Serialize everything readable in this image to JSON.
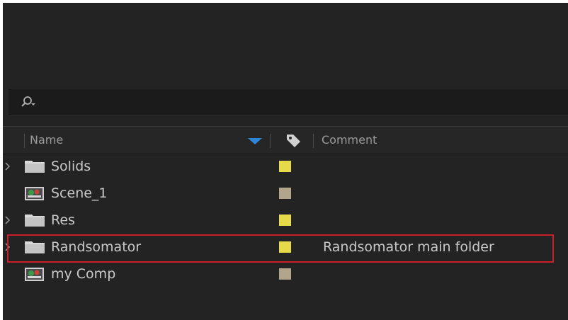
{
  "search": {
    "icon": "search-dropdown-icon"
  },
  "columns": {
    "name": "Name",
    "sort_icon": "sort-descending-icon",
    "label_icon": "tag-icon",
    "comment": "Comment"
  },
  "items": [
    {
      "name": "Solids",
      "type": "folder",
      "label_color": "#e6d94a",
      "comment": "",
      "expandable": true
    },
    {
      "name": "Scene_1",
      "type": "composition",
      "label_color": "#b3a58c",
      "comment": "",
      "expandable": false
    },
    {
      "name": "Res",
      "type": "folder",
      "label_color": "#e6d94a",
      "comment": "",
      "expandable": true
    },
    {
      "name": "Randsomator",
      "type": "folder",
      "label_color": "#e6d94a",
      "comment": "Randsomator main folder",
      "expandable": true,
      "highlighted": true
    },
    {
      "name": "my Comp",
      "type": "composition",
      "label_color": "#b3a58c",
      "comment": "",
      "expandable": false
    }
  ],
  "colors": {
    "panel_bg": "#232323",
    "highlight_border": "#c8202a",
    "sort_arrow": "#2f86d6"
  }
}
